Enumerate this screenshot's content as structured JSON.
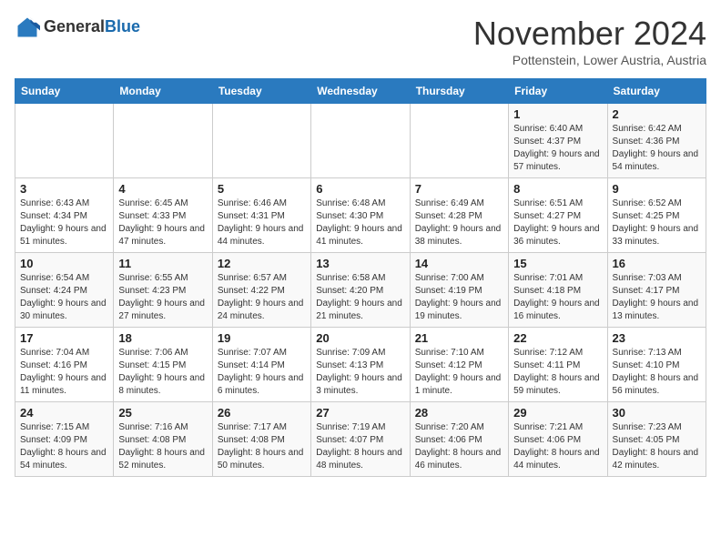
{
  "header": {
    "logo_line1": "General",
    "logo_line2": "Blue",
    "month_title": "November 2024",
    "location": "Pottenstein, Lower Austria, Austria"
  },
  "weekdays": [
    "Sunday",
    "Monday",
    "Tuesday",
    "Wednesday",
    "Thursday",
    "Friday",
    "Saturday"
  ],
  "weeks": [
    [
      {
        "day": "",
        "info": ""
      },
      {
        "day": "",
        "info": ""
      },
      {
        "day": "",
        "info": ""
      },
      {
        "day": "",
        "info": ""
      },
      {
        "day": "",
        "info": ""
      },
      {
        "day": "1",
        "info": "Sunrise: 6:40 AM\nSunset: 4:37 PM\nDaylight: 9 hours and 57 minutes."
      },
      {
        "day": "2",
        "info": "Sunrise: 6:42 AM\nSunset: 4:36 PM\nDaylight: 9 hours and 54 minutes."
      }
    ],
    [
      {
        "day": "3",
        "info": "Sunrise: 6:43 AM\nSunset: 4:34 PM\nDaylight: 9 hours and 51 minutes."
      },
      {
        "day": "4",
        "info": "Sunrise: 6:45 AM\nSunset: 4:33 PM\nDaylight: 9 hours and 47 minutes."
      },
      {
        "day": "5",
        "info": "Sunrise: 6:46 AM\nSunset: 4:31 PM\nDaylight: 9 hours and 44 minutes."
      },
      {
        "day": "6",
        "info": "Sunrise: 6:48 AM\nSunset: 4:30 PM\nDaylight: 9 hours and 41 minutes."
      },
      {
        "day": "7",
        "info": "Sunrise: 6:49 AM\nSunset: 4:28 PM\nDaylight: 9 hours and 38 minutes."
      },
      {
        "day": "8",
        "info": "Sunrise: 6:51 AM\nSunset: 4:27 PM\nDaylight: 9 hours and 36 minutes."
      },
      {
        "day": "9",
        "info": "Sunrise: 6:52 AM\nSunset: 4:25 PM\nDaylight: 9 hours and 33 minutes."
      }
    ],
    [
      {
        "day": "10",
        "info": "Sunrise: 6:54 AM\nSunset: 4:24 PM\nDaylight: 9 hours and 30 minutes."
      },
      {
        "day": "11",
        "info": "Sunrise: 6:55 AM\nSunset: 4:23 PM\nDaylight: 9 hours and 27 minutes."
      },
      {
        "day": "12",
        "info": "Sunrise: 6:57 AM\nSunset: 4:22 PM\nDaylight: 9 hours and 24 minutes."
      },
      {
        "day": "13",
        "info": "Sunrise: 6:58 AM\nSunset: 4:20 PM\nDaylight: 9 hours and 21 minutes."
      },
      {
        "day": "14",
        "info": "Sunrise: 7:00 AM\nSunset: 4:19 PM\nDaylight: 9 hours and 19 minutes."
      },
      {
        "day": "15",
        "info": "Sunrise: 7:01 AM\nSunset: 4:18 PM\nDaylight: 9 hours and 16 minutes."
      },
      {
        "day": "16",
        "info": "Sunrise: 7:03 AM\nSunset: 4:17 PM\nDaylight: 9 hours and 13 minutes."
      }
    ],
    [
      {
        "day": "17",
        "info": "Sunrise: 7:04 AM\nSunset: 4:16 PM\nDaylight: 9 hours and 11 minutes."
      },
      {
        "day": "18",
        "info": "Sunrise: 7:06 AM\nSunset: 4:15 PM\nDaylight: 9 hours and 8 minutes."
      },
      {
        "day": "19",
        "info": "Sunrise: 7:07 AM\nSunset: 4:14 PM\nDaylight: 9 hours and 6 minutes."
      },
      {
        "day": "20",
        "info": "Sunrise: 7:09 AM\nSunset: 4:13 PM\nDaylight: 9 hours and 3 minutes."
      },
      {
        "day": "21",
        "info": "Sunrise: 7:10 AM\nSunset: 4:12 PM\nDaylight: 9 hours and 1 minute."
      },
      {
        "day": "22",
        "info": "Sunrise: 7:12 AM\nSunset: 4:11 PM\nDaylight: 8 hours and 59 minutes."
      },
      {
        "day": "23",
        "info": "Sunrise: 7:13 AM\nSunset: 4:10 PM\nDaylight: 8 hours and 56 minutes."
      }
    ],
    [
      {
        "day": "24",
        "info": "Sunrise: 7:15 AM\nSunset: 4:09 PM\nDaylight: 8 hours and 54 minutes."
      },
      {
        "day": "25",
        "info": "Sunrise: 7:16 AM\nSunset: 4:08 PM\nDaylight: 8 hours and 52 minutes."
      },
      {
        "day": "26",
        "info": "Sunrise: 7:17 AM\nSunset: 4:08 PM\nDaylight: 8 hours and 50 minutes."
      },
      {
        "day": "27",
        "info": "Sunrise: 7:19 AM\nSunset: 4:07 PM\nDaylight: 8 hours and 48 minutes."
      },
      {
        "day": "28",
        "info": "Sunrise: 7:20 AM\nSunset: 4:06 PM\nDaylight: 8 hours and 46 minutes."
      },
      {
        "day": "29",
        "info": "Sunrise: 7:21 AM\nSunset: 4:06 PM\nDaylight: 8 hours and 44 minutes."
      },
      {
        "day": "30",
        "info": "Sunrise: 7:23 AM\nSunset: 4:05 PM\nDaylight: 8 hours and 42 minutes."
      }
    ]
  ]
}
